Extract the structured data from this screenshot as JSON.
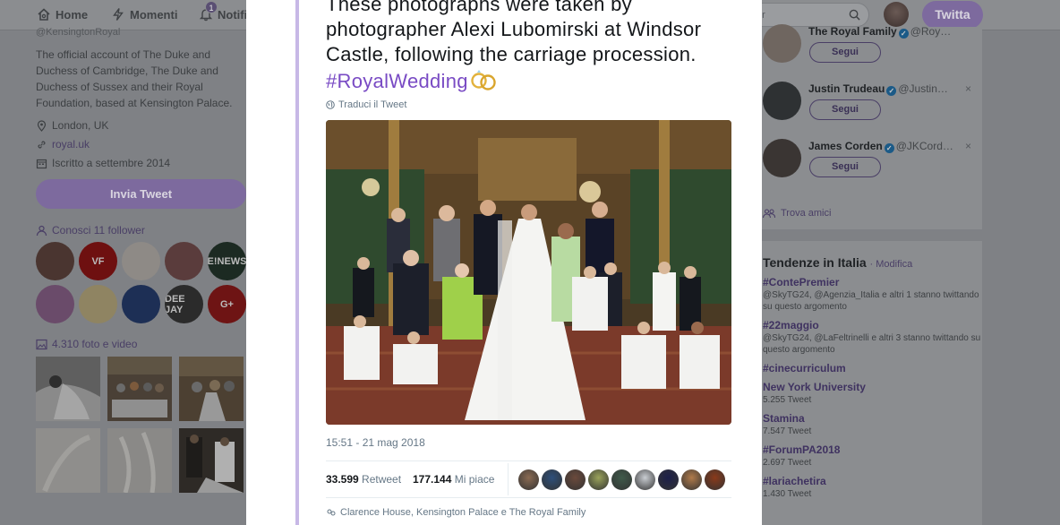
{
  "topbar": {
    "home_label": "Home",
    "moments_label": "Momenti",
    "notifications_label": "Notifi",
    "notifications_count": "1",
    "search_placeholder": "ter",
    "tweet_button": "Twitta"
  },
  "profile": {
    "handle": "@KensingtonRoyal",
    "bio": "The official account of The Duke and Duchess of Cambridge, The Duke and Duchess of Sussex and their Royal Foundation, based at Kensington Palace.",
    "location": "London, UK",
    "website": "royal.uk",
    "joined": "Iscritto a settembre 2014",
    "tweet_button": "Invia Tweet",
    "followers_label": "Conosci 11 follower",
    "followers": [
      {
        "name": "follower-1",
        "text": "",
        "color": "#4a3530"
      },
      {
        "name": "follower-vf",
        "text": "VF",
        "color": "#6e1010"
      },
      {
        "name": "follower-3",
        "text": "",
        "color": "#8e8a86"
      },
      {
        "name": "follower-4",
        "text": "",
        "color": "#5a3c3c"
      },
      {
        "name": "follower-enews",
        "text": "E!NEWS",
        "color": "#1c2a22"
      },
      {
        "name": "follower-6",
        "text": "",
        "color": "#6a4b6a"
      },
      {
        "name": "follower-7",
        "text": "",
        "color": "#8f8462"
      },
      {
        "name": "follower-8",
        "text": "",
        "color": "#1d2f55"
      },
      {
        "name": "follower-deejay",
        "text": "DEE JAY",
        "color": "#2b2b2b"
      },
      {
        "name": "follower-g",
        "text": "G+",
        "color": "#6e1414"
      }
    ],
    "media_label": "4.310 foto e video"
  },
  "who_to_follow": [
    {
      "name": "The Royal Family",
      "handle": "@Roy…",
      "follow_label": "Segui",
      "avatar_color": "#6f6660",
      "dismiss": ""
    },
    {
      "name": "Justin Trudeau",
      "handle": "@Justin…",
      "follow_label": "Segui",
      "avatar_color": "#2e3133",
      "dismiss": "×"
    },
    {
      "name": "James Corden",
      "handle": "@JKCord…",
      "follow_label": "Segui",
      "avatar_color": "#3a3533",
      "dismiss": "×"
    }
  ],
  "find_friends": "Trova amici",
  "trends": {
    "title": "Tendenze in Italia",
    "modify": "· Modifica",
    "items": [
      {
        "name": "#ContePremier",
        "sub": "@SkyTG24, @Agenzia_Italia e altri 1 stanno twittando su questo argomento"
      },
      {
        "name": "#22maggio",
        "sub": "@SkyTG24, @LaFeltrinelli e altri 3 stanno twittando su questo argomento"
      },
      {
        "name": "#cinecurriculum",
        "sub": ""
      },
      {
        "name": "New York University",
        "sub": "5.255 Tweet"
      },
      {
        "name": "Stamina",
        "sub": "7.547 Tweet"
      },
      {
        "name": "#ForumPA2018",
        "sub": "2.697 Tweet"
      },
      {
        "name": "#lariachetira",
        "sub": "1.430 Tweet"
      }
    ]
  },
  "tweet": {
    "text": "These photographs were taken by photographer Alexi Lubomirski at Windsor Castle, following the carriage procession. ",
    "hashtag": "#RoyalWedding",
    "translate": "Traduci il Tweet",
    "timestamp": "15:51 - 21 mag 2018",
    "retweets_count": "33.599",
    "retweets_label": "Retweet",
    "likes_count": "177.144",
    "likes_label": "Mi piace",
    "likers": [
      "#8a6a52",
      "#2d4f7a",
      "#6b4a3c",
      "#9aa35a",
      "#3f5a4a",
      "#c9cdd2",
      "#1c1f4a",
      "#b07a4a",
      "#8a3a1a"
    ],
    "reply_to": "Clarence House, Kensington Palace e The Royal Family"
  },
  "colors": {
    "accent": "#794bc4",
    "thread_line": "#c7b8e6",
    "text_secondary": "#657786"
  }
}
